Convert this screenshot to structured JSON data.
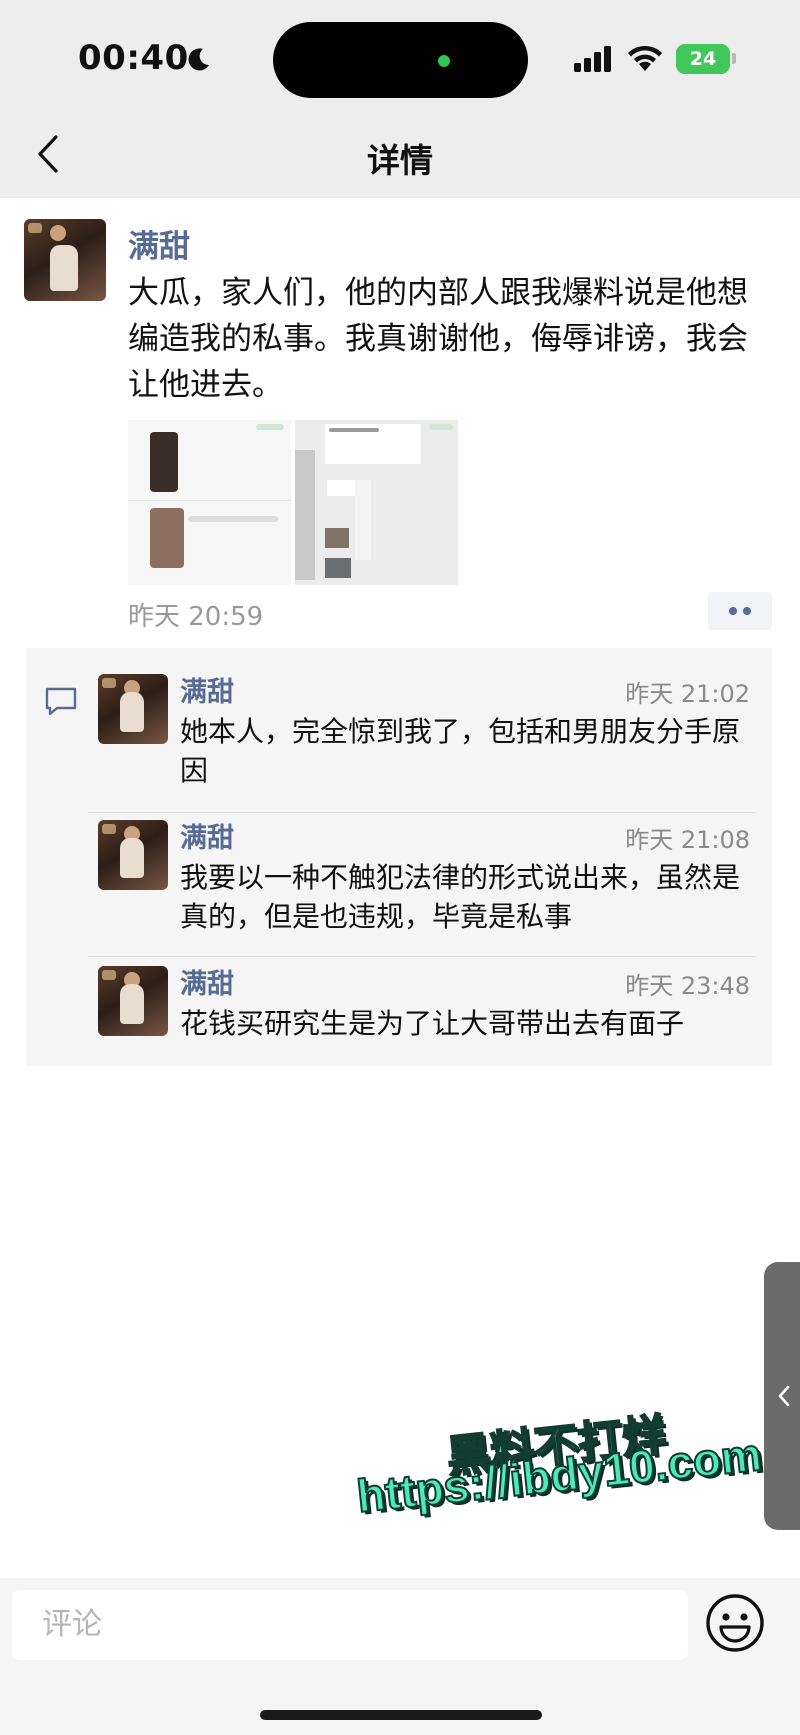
{
  "status_bar": {
    "time": "00:40",
    "battery": "24"
  },
  "nav": {
    "title": "详情",
    "back_icon": "chevron-left-icon"
  },
  "post": {
    "author": "满甜",
    "text": "大瓜，家人们，他的内部人跟我爆料说是他想编造我的私事。我真谢谢他，侮辱诽谤，我会让他进去。",
    "time": "昨天 20:59",
    "images_count": 2
  },
  "comments": [
    {
      "author": "满甜",
      "time": "昨天 21:02",
      "text": "她本人，完全惊到我了，包括和男朋友分手原因"
    },
    {
      "author": "满甜",
      "time": "昨天 21:08",
      "text": "我要以一种不触犯法律的形式说出来，虽然是真的，但是也违规，毕竟是私事"
    },
    {
      "author": "满甜",
      "time": "昨天 23:48",
      "text": "花钱买研究生是为了让大哥带出去有面子"
    }
  ],
  "watermark": {
    "line1": "黑料不打烊",
    "line2": "https://ibdy10.com"
  },
  "input": {
    "placeholder": "评论"
  },
  "colors": {
    "name_link": "#576b95",
    "top_bg": "#ededed",
    "watermark": "#4ee9b8"
  }
}
